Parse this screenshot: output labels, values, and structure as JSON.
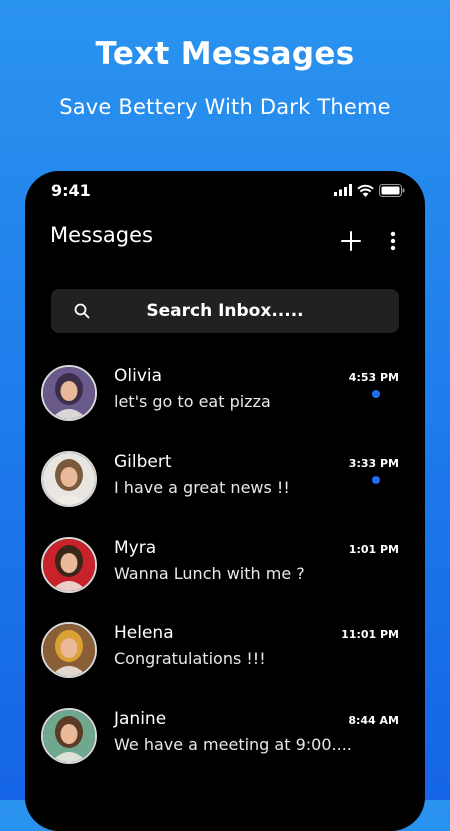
{
  "promo": {
    "title": "Text Messages",
    "subtitle": "Save Bettery With Dark Theme"
  },
  "status_bar": {
    "time": "9:41"
  },
  "header": {
    "title": "Messages",
    "add_icon": "plus-icon",
    "more_icon": "more-vertical-icon"
  },
  "search": {
    "placeholder": "Search Inbox.....",
    "icon": "search-icon"
  },
  "conversations": [
    {
      "name": "Olivia",
      "snippet": "let's go to eat pizza",
      "time": "4:53 PM",
      "unread": true,
      "avatar_bg": "#6a5a8c",
      "avatar_top": "#3a2e4a"
    },
    {
      "name": "Gilbert",
      "snippet": "I have a great news !!",
      "time": "3:33 PM",
      "unread": true,
      "avatar_bg": "#e9e6e1",
      "avatar_top": "#7a5a3c"
    },
    {
      "name": "Myra",
      "snippet": "Wanna Lunch with me ?",
      "time": "1:01 PM",
      "unread": false,
      "avatar_bg": "#c8232a",
      "avatar_top": "#3b2418"
    },
    {
      "name": "Helena",
      "snippet": "Congratulations !!!",
      "time": "11:01 PM",
      "unread": false,
      "avatar_bg": "#8a5f38",
      "avatar_top": "#d9a233"
    },
    {
      "name": "Janine",
      "snippet": "We have a meeting at 9:00....",
      "time": "8:44 AM",
      "unread": false,
      "avatar_bg": "#6fa88f",
      "avatar_top": "#5b3a26"
    }
  ],
  "colors": {
    "accent": "#1f6ff0",
    "background_top": "#2a93ee",
    "background_bottom": "#1565e6",
    "phone": "#000000",
    "search_bg": "#212121"
  }
}
